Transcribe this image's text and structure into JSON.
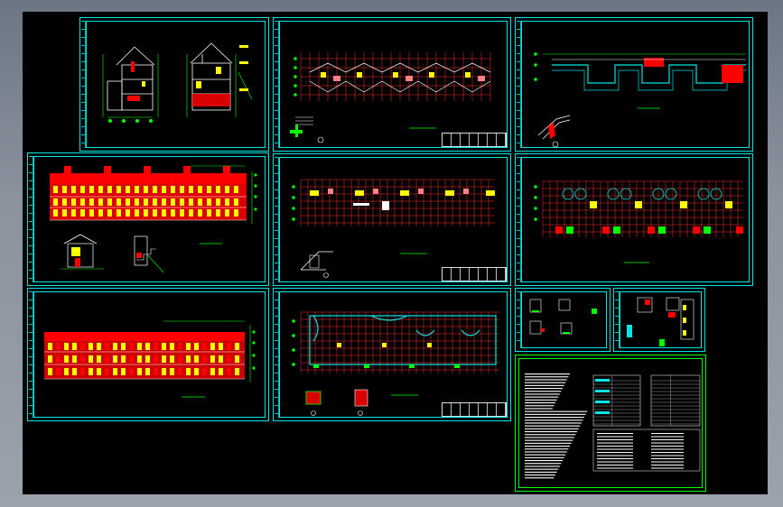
{
  "app": {
    "window_title": "",
    "colors": {
      "background_gradient_top": "#6c7683",
      "canvas": "#000000",
      "frame": "#00e5e5",
      "wall": "#ff0000",
      "window": "#ffff00",
      "dimension": "#00ff00",
      "text": "#ffffff",
      "hatch": "#ff2d2d"
    }
  },
  "sheets": [
    {
      "id": "sheet-sections",
      "kind": "section-drawings",
      "number_marker": ""
    },
    {
      "id": "sheet-roof-plan",
      "kind": "floor-plan",
      "number_marker": "①"
    },
    {
      "id": "sheet-foundation-section",
      "kind": "wall-section",
      "number_marker": "①"
    },
    {
      "id": "sheet-front-elevation",
      "kind": "elevation",
      "number_marker": ""
    },
    {
      "id": "sheet-second-floor-plan",
      "kind": "floor-plan",
      "number_marker": "①"
    },
    {
      "id": "sheet-ground-floor-plan",
      "kind": "floor-plan",
      "number_marker": ""
    },
    {
      "id": "sheet-rear-elevation",
      "kind": "elevation",
      "number_marker": ""
    },
    {
      "id": "sheet-typical-floor-plan",
      "kind": "floor-plan",
      "number_marker": "①"
    },
    {
      "id": "sheet-details-a",
      "kind": "details",
      "number_marker": ""
    },
    {
      "id": "sheet-details-b",
      "kind": "details",
      "number_marker": ""
    },
    {
      "id": "sheet-design-notes",
      "kind": "notes",
      "number_marker": ""
    }
  ]
}
